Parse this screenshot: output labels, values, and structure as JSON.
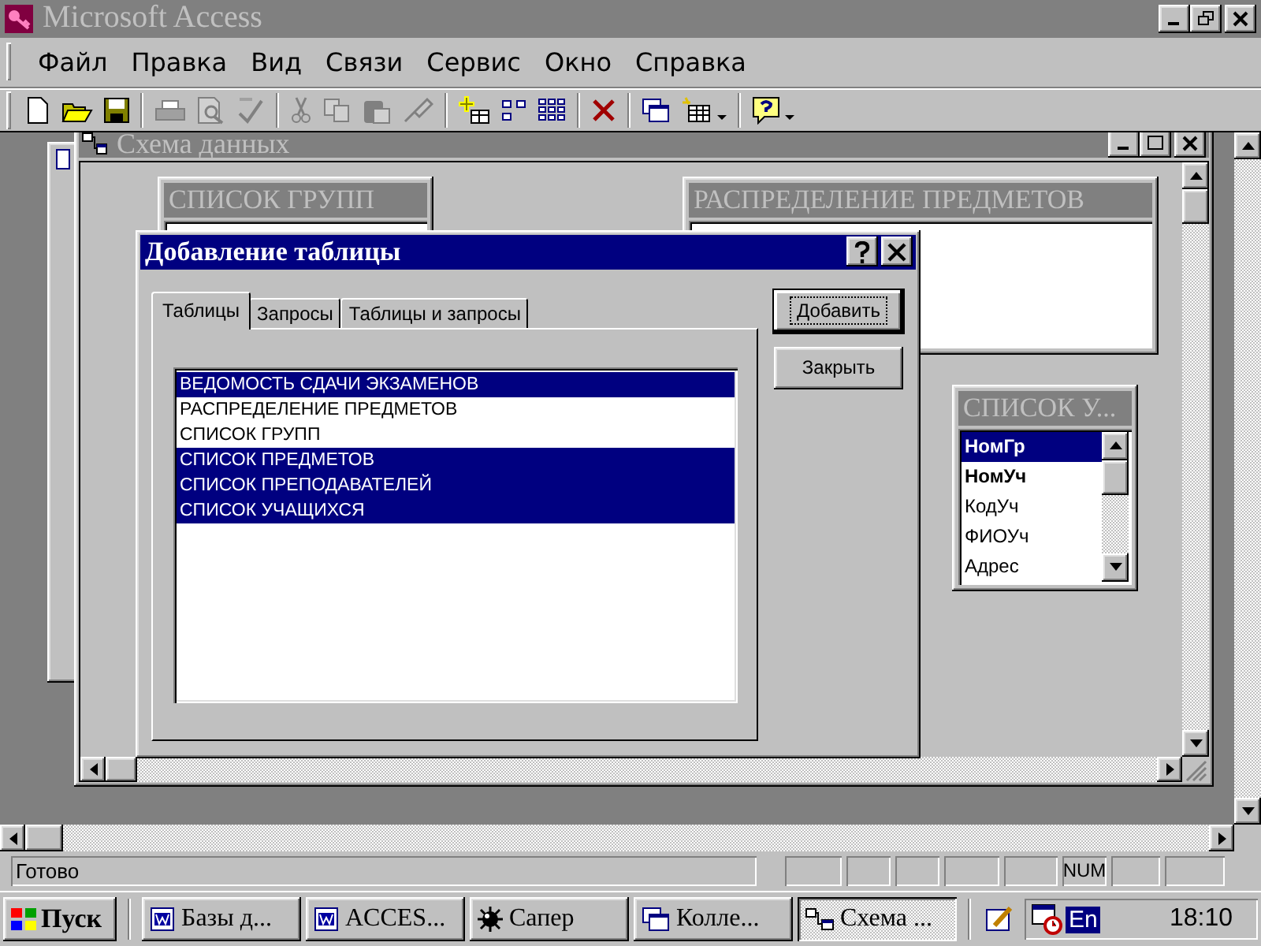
{
  "window": {
    "title": "Microsoft Access"
  },
  "menu": [
    {
      "label": "Файл"
    },
    {
      "label": "Правка"
    },
    {
      "label": "Вид"
    },
    {
      "label": "Связи"
    },
    {
      "label": "Сервис"
    },
    {
      "label": "Окно"
    },
    {
      "label": "Справка"
    }
  ],
  "schema_window": {
    "title": "Схема данных",
    "tables": [
      {
        "title": "СПИСОК ГРУПП"
      },
      {
        "title": "РАСПРЕДЕЛЕНИЕ ПРЕДМЕТОВ"
      },
      {
        "title": "СПИСОК У...",
        "fields": [
          {
            "name": "НомГр",
            "key": true,
            "selected": true
          },
          {
            "name": "НомУч",
            "key": true,
            "selected": false
          },
          {
            "name": "КодУч",
            "key": false,
            "selected": false
          },
          {
            "name": "ФИОУч",
            "key": false,
            "selected": false
          },
          {
            "name": "Адрес",
            "key": false,
            "selected": false
          }
        ]
      }
    ]
  },
  "dialog": {
    "title": "Добавление таблицы",
    "tabs": [
      {
        "label": "Таблицы",
        "selected": true
      },
      {
        "label": "Запросы",
        "selected": false
      },
      {
        "label": "Таблицы и запросы",
        "selected": false
      }
    ],
    "items": [
      {
        "label": "ВЕДОМОСТЬ СДАЧИ ЭКЗАМЕНОВ",
        "selected": true
      },
      {
        "label": "РАСПРЕДЕЛЕНИЕ ПРЕДМЕТОВ",
        "selected": false
      },
      {
        "label": "СПИСОК ГРУПП",
        "selected": false
      },
      {
        "label": "СПИСОК ПРЕДМЕТОВ",
        "selected": true
      },
      {
        "label": "СПИСОК ПРЕПОДАВАТЕЛЕЙ",
        "selected": true
      },
      {
        "label": "СПИСОК УЧАЩИХСЯ",
        "selected": true
      }
    ],
    "buttons": [
      {
        "label": "Добавить",
        "default": true
      },
      {
        "label": "Закрыть",
        "default": false
      }
    ]
  },
  "status_bar": {
    "text": "Готово",
    "indicator": "NUM"
  },
  "taskbar": {
    "start": "Пуск",
    "tasks": [
      {
        "label": "Базы д...",
        "kind": "word",
        "selected": false
      },
      {
        "label": "ACCES...",
        "kind": "word",
        "selected": false
      },
      {
        "label": "Сапер",
        "kind": "mine",
        "selected": false
      },
      {
        "label": "Колле...",
        "kind": "windows",
        "selected": false
      },
      {
        "label": "Схема ...",
        "kind": "schema",
        "selected": true
      }
    ],
    "lang": "En",
    "time": "18:10"
  }
}
